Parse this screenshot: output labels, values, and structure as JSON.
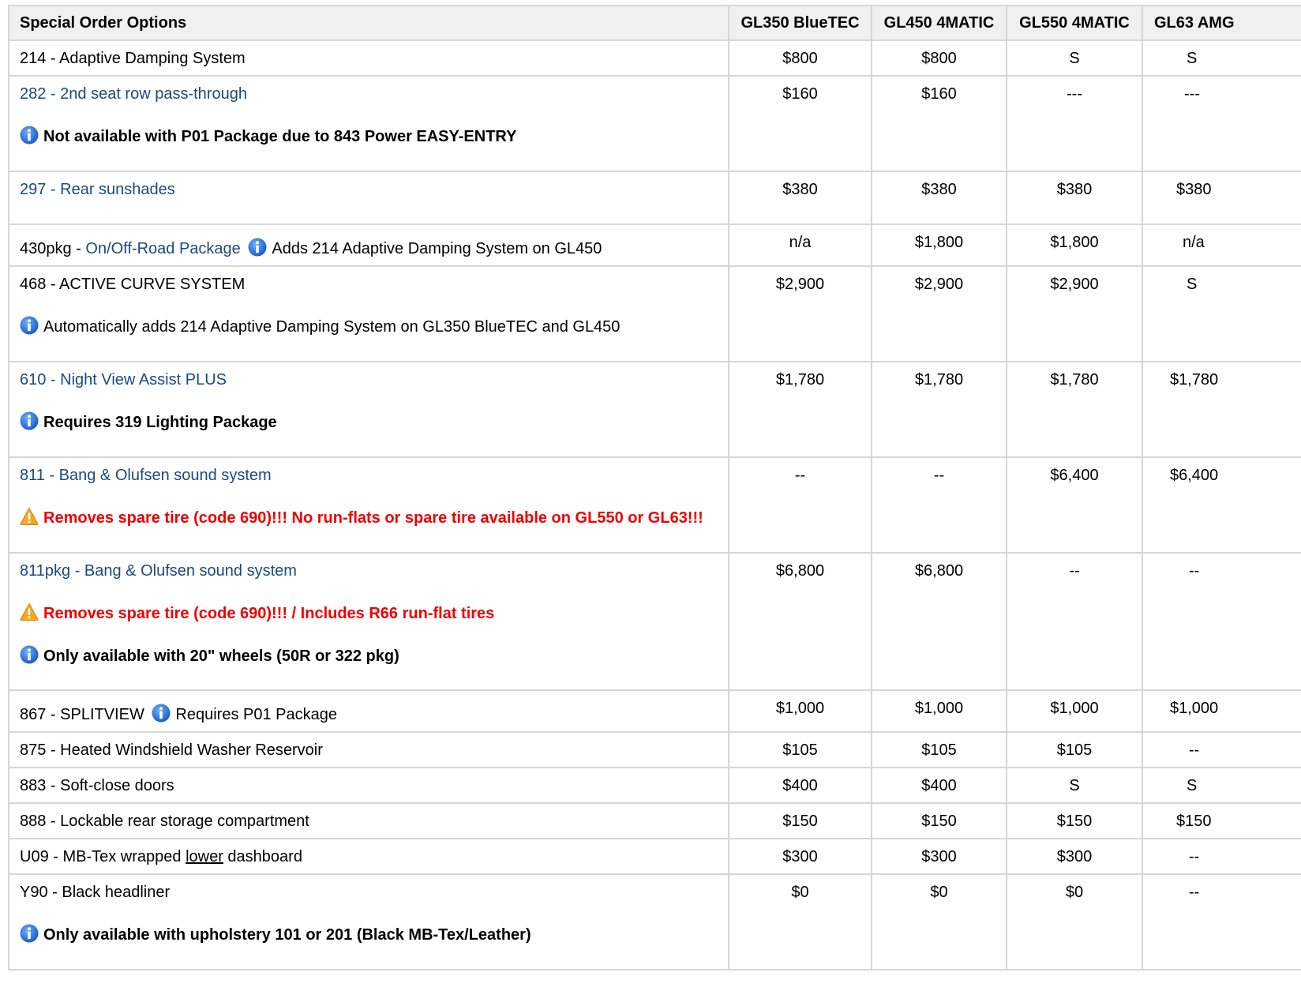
{
  "headers": {
    "option": "Special Order Options",
    "models": [
      "GL350 BlueTEC",
      "GL450 4MATIC",
      "GL550 4MATIC",
      "GL63 AMG"
    ]
  },
  "rows": [
    {
      "code": "214 - Adaptive Damping System",
      "prices": [
        "$800",
        "$800",
        "S",
        "S"
      ]
    },
    {
      "code": "282 - 2nd seat row pass-through",
      "note": "Not available with P01 Package due to 843 Power EASY-ENTRY",
      "prices": [
        "$160",
        "$160",
        "---",
        "---"
      ]
    },
    {
      "code": "297 - Rear sunshades",
      "prices": [
        "$380",
        "$380",
        "$380",
        "$380"
      ]
    },
    {
      "code_prefix": "430pkg - ",
      "code_link": "On/Off-Road Package",
      "inline_note": "Adds 214 Adaptive Damping System on GL450",
      "prices": [
        "n/a",
        "$1,800",
        "$1,800",
        "n/a"
      ]
    },
    {
      "code": "468 - ACTIVE CURVE SYSTEM",
      "note": "Automatically adds 214 Adaptive Damping System on GL350 BlueTEC and GL450",
      "prices": [
        "$2,900",
        "$2,900",
        "$2,900",
        "S"
      ]
    },
    {
      "code": "610 - Night View Assist PLUS",
      "note": "Requires 319 Lighting Package",
      "prices": [
        "$1,780",
        "$1,780",
        "$1,780",
        "$1,780"
      ]
    },
    {
      "code": "811 - Bang & Olufsen sound system",
      "warning": "Removes spare tire (code 690)!!! No run-flats or spare tire available on GL550 or GL63!!!",
      "prices": [
        "--",
        "--",
        "$6,400",
        "$6,400"
      ]
    },
    {
      "code": "811pkg - Bang & Olufsen sound system",
      "warning": "Removes spare tire (code 690)!!! / Includes R66 run-flat tires",
      "note": "Only available with 20\" wheels (50R or 322 pkg)",
      "prices": [
        "$6,800",
        "$6,800",
        "--",
        "--"
      ]
    },
    {
      "code": "867 - SPLITVIEW",
      "inline_note": "Requires P01 Package",
      "prices": [
        "$1,000",
        "$1,000",
        "$1,000",
        "$1,000"
      ]
    },
    {
      "code": "875 - Heated Windshield Washer Reservoir",
      "prices": [
        "$105",
        "$105",
        "$105",
        "--"
      ]
    },
    {
      "code": "883 - Soft-close doors",
      "prices": [
        "$400",
        "$400",
        "S",
        "S"
      ]
    },
    {
      "code": "888 - Lockable rear storage compartment",
      "prices": [
        "$150",
        "$150",
        "$150",
        "$150"
      ]
    },
    {
      "code_a": "U09 - MB-Tex wrapped ",
      "code_u": "lower",
      "code_b": " dashboard",
      "prices": [
        "$300",
        "$300",
        "$300",
        "--"
      ]
    },
    {
      "code": "Y90 - Black headliner",
      "note": "Only available with upholstery 101 or 201 (Black MB-Tex/Leather)",
      "prices": [
        "$0",
        "$0",
        "$0",
        "--"
      ]
    }
  ],
  "colors": {
    "link": "#1a4b7a",
    "warning_text": "#ee0000",
    "info_icon": "#1f6fd6",
    "warning_icon": "#f5a623",
    "grid": "#d6d6d6",
    "header_bg": "#f0f0f0"
  },
  "icons": {
    "info": "info-icon",
    "warning": "warning-icon"
  }
}
